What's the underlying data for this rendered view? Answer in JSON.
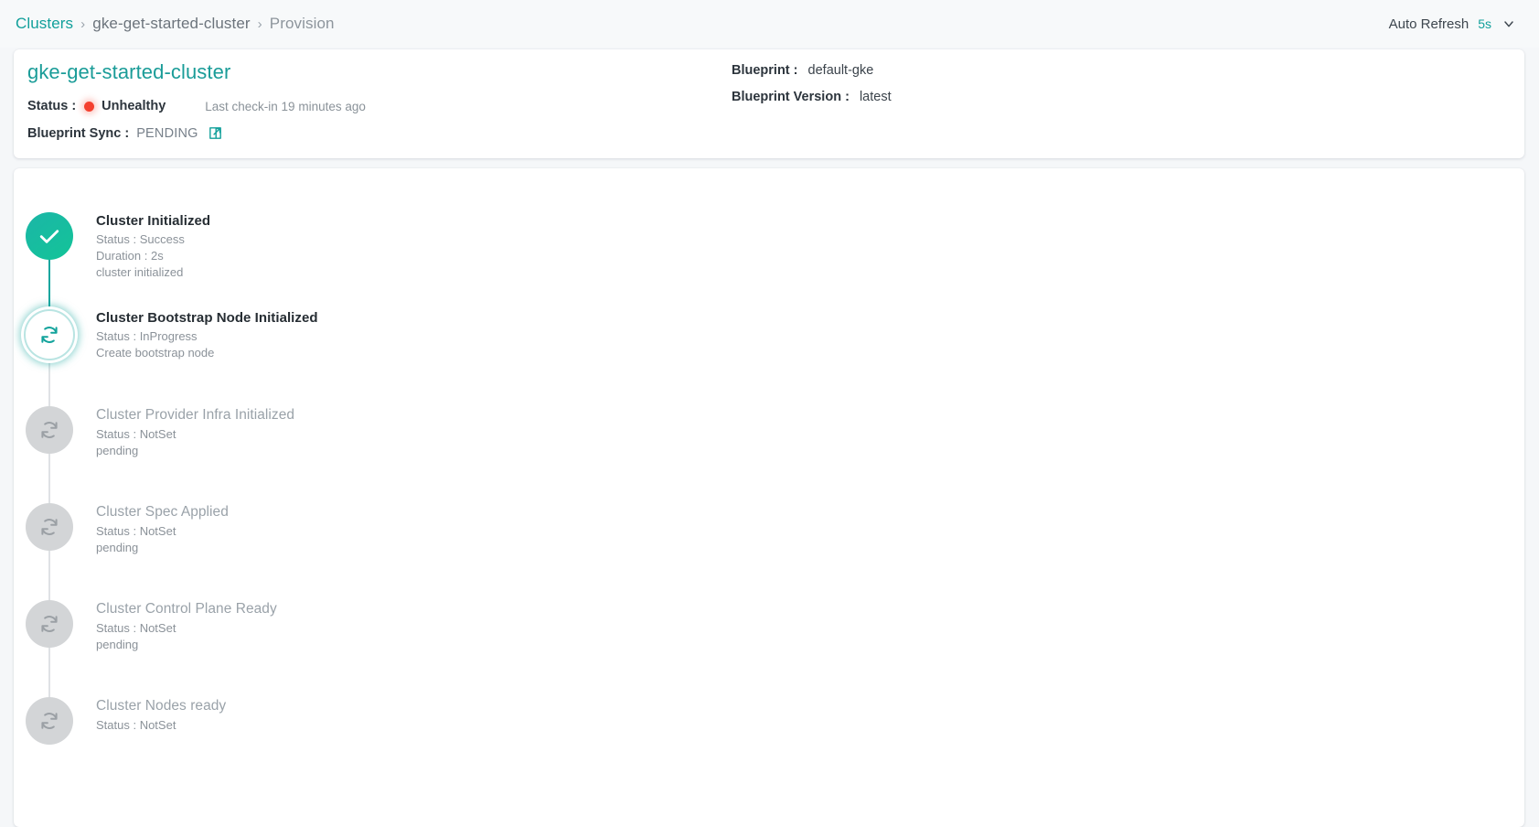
{
  "breadcrumb": {
    "root": "Clusters",
    "separator": "›",
    "middle": "gke-get-started-cluster",
    "current": "Provision"
  },
  "auto_refresh": {
    "label": "Auto Refresh",
    "interval": "5s",
    "caret_icon": "chevron-down-icon"
  },
  "summary": {
    "cluster_name": "gke-get-started-cluster",
    "status_label": "Status :",
    "status_value": "Unhealthy",
    "status_color": "#f4402f",
    "last_checkin": "Last check-in 19 minutes ago",
    "blueprint_sync_label": "Blueprint Sync :",
    "blueprint_sync_value": "PENDING",
    "blueprint_sync_link_icon": "external-link-icon",
    "blueprint_label": "Blueprint :",
    "blueprint_value": "default-gke",
    "blueprint_version_label": "Blueprint Version :",
    "blueprint_version_value": "latest"
  },
  "accent_color": "#12a09b",
  "timeline": {
    "steps": [
      {
        "title": "Cluster Initialized",
        "status_line": "Status : Success",
        "duration_line": "Duration : 2s",
        "message": "cluster initialized",
        "state": "success",
        "icon": "check-icon"
      },
      {
        "title": "Cluster Bootstrap Node Initialized",
        "status_line": "Status : InProgress",
        "duration_line": "",
        "message": "Create bootstrap node",
        "state": "inprogress",
        "icon": "refresh-spinner-icon"
      },
      {
        "title": "Cluster Provider Infra Initialized",
        "status_line": "Status : NotSet",
        "duration_line": "",
        "message": "pending",
        "state": "notset",
        "icon": "refresh-icon"
      },
      {
        "title": "Cluster Spec Applied",
        "status_line": "Status : NotSet",
        "duration_line": "",
        "message": "pending",
        "state": "notset",
        "icon": "refresh-icon"
      },
      {
        "title": "Cluster Control Plane Ready",
        "status_line": "Status : NotSet",
        "duration_line": "",
        "message": "pending",
        "state": "notset",
        "icon": "refresh-icon"
      },
      {
        "title": "Cluster Nodes ready",
        "status_line": "Status : NotSet",
        "duration_line": "",
        "message": "",
        "state": "notset",
        "icon": "refresh-icon"
      }
    ]
  }
}
